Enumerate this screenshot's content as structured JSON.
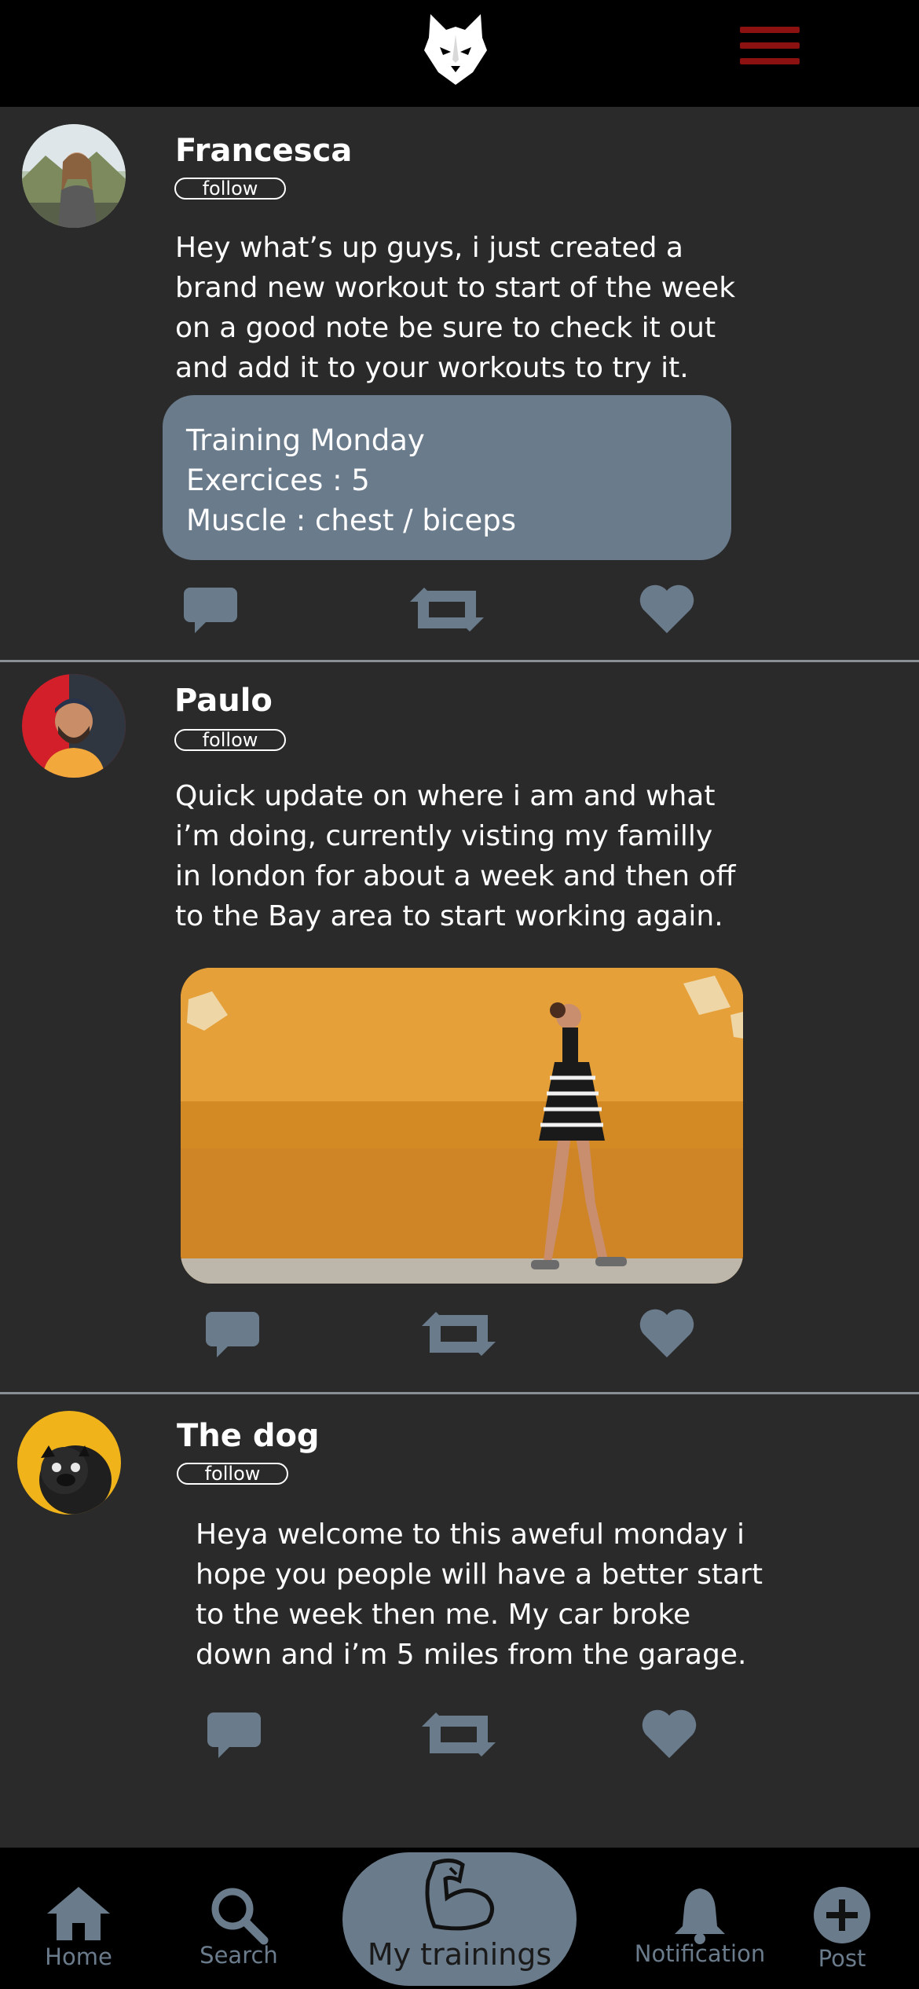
{
  "colors": {
    "background": "#2a2a2b",
    "bar": "#000000",
    "accent": "#6a7b8c",
    "menu": "#8c1212",
    "text": "#ffffff"
  },
  "header": {
    "logo_icon": "wolf-head-logo-icon",
    "menu_icon": "hamburger-menu-icon"
  },
  "posts": [
    {
      "name": "Francesca",
      "follow_label": "follow",
      "text": "Hey what’s up guys, i just created a\nbrand new workout to start of the week\non a good note be sure to check it out\nand add it to your workouts to try it.",
      "training": {
        "title": "Training Monday",
        "exercises": "Exercices : 5",
        "muscle": "Muscle : chest / biceps"
      },
      "actions": [
        "comment-icon",
        "repost-icon",
        "heart-icon"
      ]
    },
    {
      "name": "Paulo",
      "follow_label": "follow",
      "text": "Quick update on where i am and what\ni’m doing, currently visting my familly\nin london for about a week and then off\nto the Bay area to start working again.",
      "actions": [
        "comment-icon",
        "repost-icon",
        "heart-icon"
      ]
    },
    {
      "name": "The dog",
      "follow_label": "follow",
      "text": "Heya welcome to this aweful monday i\nhope you people will have a better start\nto the week then me. My car broke\ndown and i’m 5 miles from the garage.",
      "actions": [
        "comment-icon",
        "repost-icon",
        "heart-icon"
      ]
    }
  ],
  "nav": {
    "home": "Home",
    "search": "Search",
    "my_trainings": "My trainings",
    "notification": "Notification",
    "post": "Post"
  }
}
